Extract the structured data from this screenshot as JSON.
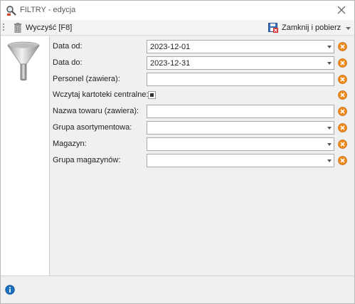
{
  "window": {
    "title": "FILTRY - edycja"
  },
  "toolbar": {
    "clear_label": "Wyczyść [F8]",
    "close_label": "Zamknij i pobierz"
  },
  "fields": [
    {
      "label": "Data od:",
      "type": "combo",
      "value": "2023-12-01"
    },
    {
      "label": "Data do:",
      "type": "combo",
      "value": "2023-12-31"
    },
    {
      "label": "Personel (zawiera):",
      "type": "text",
      "value": ""
    },
    {
      "label": "Wczytaj kartoteki centralne:",
      "type": "checkbox",
      "value": ""
    },
    {
      "label": "Nazwa towaru (zawiera):",
      "type": "text",
      "value": ""
    },
    {
      "label": "Grupa asortymentowa:",
      "type": "combo",
      "value": ""
    },
    {
      "label": "Magazyn:",
      "type": "combo",
      "value": ""
    },
    {
      "label": "Grupa magazynów:",
      "type": "combo",
      "value": ""
    }
  ],
  "colors": {
    "clear_icon": "#f08a1c",
    "info_icon": "#1b6fc2",
    "window_border": "#b9b9b9"
  }
}
